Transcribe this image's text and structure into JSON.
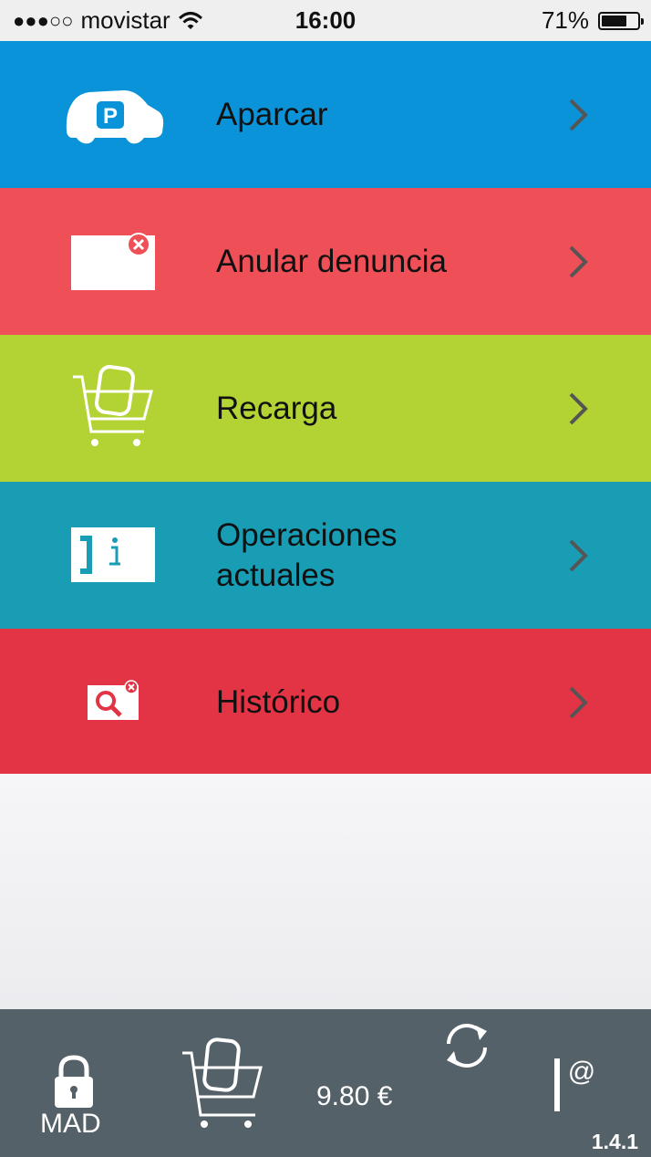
{
  "status_bar": {
    "signal": "●●●○○",
    "carrier": "movistar",
    "time": "16:00",
    "battery_percent": "71%",
    "battery_level": 0.71,
    "icons": [
      "signal-dots-icon",
      "wifi-icon",
      "battery-icon"
    ]
  },
  "menu": {
    "items": [
      {
        "label": "Aparcar",
        "color": "#0a93d8",
        "icon": "parking-car-icon"
      },
      {
        "label": "Anular denuncia",
        "color": "#ef5058",
        "icon": "cancel-ticket-icon"
      },
      {
        "label": "Recarga",
        "color": "#b3d335",
        "icon": "recharge-cart-icon"
      },
      {
        "label": "Operaciones actuales",
        "label_line1": "Operaciones",
        "label_line2": "actuales",
        "color": "#189db4",
        "icon": "info-ticket-icon"
      },
      {
        "label": "Histórico",
        "color": "#e23444",
        "icon": "history-search-icon"
      }
    ],
    "chevron_icon": "chevron-right-icon"
  },
  "bottom_bar": {
    "city_label": "MAD",
    "balance": "9.80 €",
    "version": "1.4.1",
    "color": "#556168",
    "icons": [
      "lock-icon",
      "cart-icon",
      "refresh-icon",
      "at-logo-icon"
    ]
  }
}
